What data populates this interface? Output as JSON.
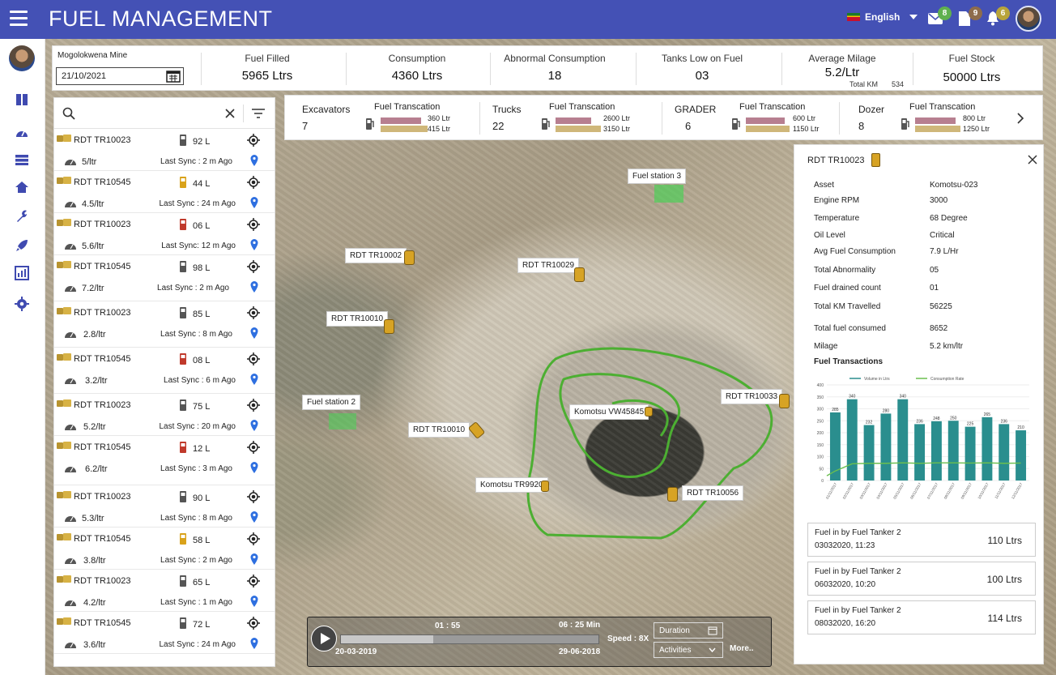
{
  "app": {
    "title": "FUEL MANAGEMENT",
    "language": "English"
  },
  "notifications": {
    "mail": "8",
    "files": "9",
    "alerts": "6"
  },
  "colors": {
    "topbar": "#4451b5",
    "badge_green": "#5fb04f",
    "badge_brown": "#8e6c4c",
    "badge_olive": "#b8a43a",
    "route": "#4caf32"
  },
  "filters": {
    "mine": "Mogolokwena Mine",
    "date": "21/10/2021"
  },
  "stats": [
    {
      "label": "Fuel Filled",
      "value": "5965 Ltrs"
    },
    {
      "label": "Consumption",
      "value": "4360 Ltrs"
    },
    {
      "label": "Abnormal Consumption",
      "value": "18"
    },
    {
      "label": "Tanks Low on Fuel",
      "value": "03"
    },
    {
      "label": "Average Milage",
      "value": "5.2/Ltr",
      "extra_label": "Total KM",
      "extra_value": "534"
    },
    {
      "label": "Fuel Stock",
      "value": "50000 Ltrs"
    }
  ],
  "fleet": [
    {
      "name": "Excavators",
      "count": "7",
      "tx_label": "Fuel Transcation",
      "v1": "360 Ltr",
      "v2": "415 Ltr"
    },
    {
      "name": "Trucks",
      "count": "22",
      "tx_label": "Fuel Transcation",
      "v1": "2600 Ltr",
      "v2": "3150 Ltr"
    },
    {
      "name": "GRADER",
      "count": "6",
      "tx_label": "Fuel Transcation",
      "v1": "600 Ltr",
      "v2": "1150 Ltr"
    },
    {
      "name": "Dozer",
      "count": "8",
      "tx_label": "Fuel Transcation",
      "v1": "800 Ltr",
      "v2": "1250 Ltr"
    }
  ],
  "vehicles": [
    {
      "name": "RDT TR10023",
      "fuel": "92 L",
      "rate": "5/ltr",
      "sync_label": "Last Sync :",
      "sync": "2 m Ago",
      "level": "gray"
    },
    {
      "name": "RDT TR10545",
      "fuel": "44 L",
      "rate": "4.5/ltr",
      "sync_label": "Last Sync :",
      "sync": "24 m Ago",
      "level": "yellow"
    },
    {
      "name": "RDT TR10023",
      "fuel": "06 L",
      "rate": "5.6/ltr",
      "sync_label": "Last Sync:",
      "sync": "12 m Ago",
      "level": "red"
    },
    {
      "name": "RDT TR10545",
      "fuel": "98 L",
      "rate": "7.2/ltr",
      "sync_label": "Last Sync :",
      "sync": "2 m Ago",
      "level": "gray"
    },
    {
      "name": "RDT TR10023",
      "fuel": "85 L",
      "rate": "2.8/ltr",
      "sync_label": "Last Sync :",
      "sync": "8 m Ago",
      "level": "gray"
    },
    {
      "name": "RDT TR10545",
      "fuel": "08 L",
      "rate": "3.2/ltr",
      "sync_label": "Last Sync :",
      "sync": "6 m Ago",
      "level": "red"
    },
    {
      "name": "RDT TR10023",
      "fuel": "75 L",
      "rate": "5.2/ltr",
      "sync_label": "Last Sync :",
      "sync": "20 m Ago",
      "level": "gray"
    },
    {
      "name": "RDT TR10545",
      "fuel": "12 L",
      "rate": "6.2/ltr",
      "sync_label": "Last Sync :",
      "sync": "3 m Ago",
      "level": "red"
    },
    {
      "name": "RDT TR10023",
      "fuel": "90 L",
      "rate": "5.3/ltr",
      "sync_label": "Last Sync :",
      "sync": "8 m Ago",
      "level": "gray"
    },
    {
      "name": "RDT TR10545",
      "fuel": "58 L",
      "rate": "3.8/ltr",
      "sync_label": "Last Sync :",
      "sync": "2 m Ago",
      "level": "yellow"
    },
    {
      "name": "RDT TR10023",
      "fuel": "65 L",
      "rate": "4.2/ltr",
      "sync_label": "Last Sync :",
      "sync": "1 m Ago",
      "level": "gray"
    },
    {
      "name": "RDT TR10545",
      "fuel": "72 L",
      "rate": "3.6/ltr",
      "sync_label": "Last Sync :",
      "sync": "24 m Ago",
      "level": "gray"
    }
  ],
  "map_labels": {
    "fs3": "Fuel station 3",
    "fs2": "Fuel station 2",
    "t1": "RDT TR10002",
    "t2": "RDT TR10029",
    "t3": "RDT TR10010",
    "t4": "RDT TR10033",
    "t5": "RDT TR10010",
    "t6": "Komotsu VW45845",
    "t7": "Komotsu TR9920",
    "t8": "RDT TR10056"
  },
  "detail": {
    "title": "RDT TR10023",
    "rows": [
      {
        "label": "Asset",
        "value": "Komotsu-023"
      },
      {
        "label": "Engine RPM",
        "value": "3000"
      },
      {
        "label": "Temperature",
        "value": "68 Degree"
      },
      {
        "label": "Oil Level",
        "value": "Critical"
      },
      {
        "label": "Avg Fuel Consumption",
        "value": "7.9 L/Hr"
      },
      {
        "label": "Total  Abnormality",
        "value": "05"
      },
      {
        "label": "Fuel drained count",
        "value": "01"
      },
      {
        "label": "Total KM Travelled",
        "value": "56225"
      },
      {
        "label": "Total fuel consumed",
        "value": "8652"
      },
      {
        "label": "Milage",
        "value": "5.2 km/ltr"
      }
    ],
    "section": "Fuel Transactions",
    "transactions": [
      {
        "title": "Fuel in by Fuel Tanker 2",
        "date": "03032020, 11:23",
        "amount": "110 Ltrs"
      },
      {
        "title": "Fuel in by Fuel Tanker 2",
        "date": "06032020, 10:20",
        "amount": "100 Ltrs"
      },
      {
        "title": "Fuel in by Fuel Tanker 2",
        "date": "08032020, 16:20",
        "amount": "114 Ltrs"
      }
    ]
  },
  "chart_data": {
    "type": "bar",
    "categories": [
      "01/11/2017",
      "02/11/2017",
      "03/11/2017",
      "04/11/2017",
      "05/11/2017",
      "06/11/2017",
      "07/11/2017",
      "08/11/2017",
      "09/11/2017",
      "10/11/2017",
      "11/11/2017",
      "12/11/2017"
    ],
    "series": [
      {
        "name": "Volume in Ltrs",
        "values": [
          285,
          340,
          232,
          280,
          340,
          236,
          248,
          250,
          225,
          265,
          236,
          210
        ],
        "color": "#2a8e8e"
      },
      {
        "name": "Consumption Rate",
        "values": [
          40,
          70,
          72,
          72,
          74,
          72,
          74,
          74,
          73,
          74,
          72,
          73
        ],
        "color": "#6bbf4f"
      }
    ],
    "data_labels": [
      "285",
      "340",
      "232",
      "280",
      "340",
      "236",
      "248",
      "250",
      "225",
      "265",
      "236",
      "210"
    ],
    "yticks": [
      "0",
      "50",
      "100",
      "150",
      "200",
      "250",
      "300",
      "350",
      "400"
    ],
    "ylim": [
      0,
      400
    ]
  },
  "player": {
    "elapsed": "01 : 55",
    "total": "06 : 25  Min",
    "start_date": "20-03-2019",
    "end_date": "29-06-2018",
    "speed": "Speed : 8X",
    "duration": "Duration",
    "activities": "Activities",
    "more": "More..",
    "progress": 0.36
  }
}
